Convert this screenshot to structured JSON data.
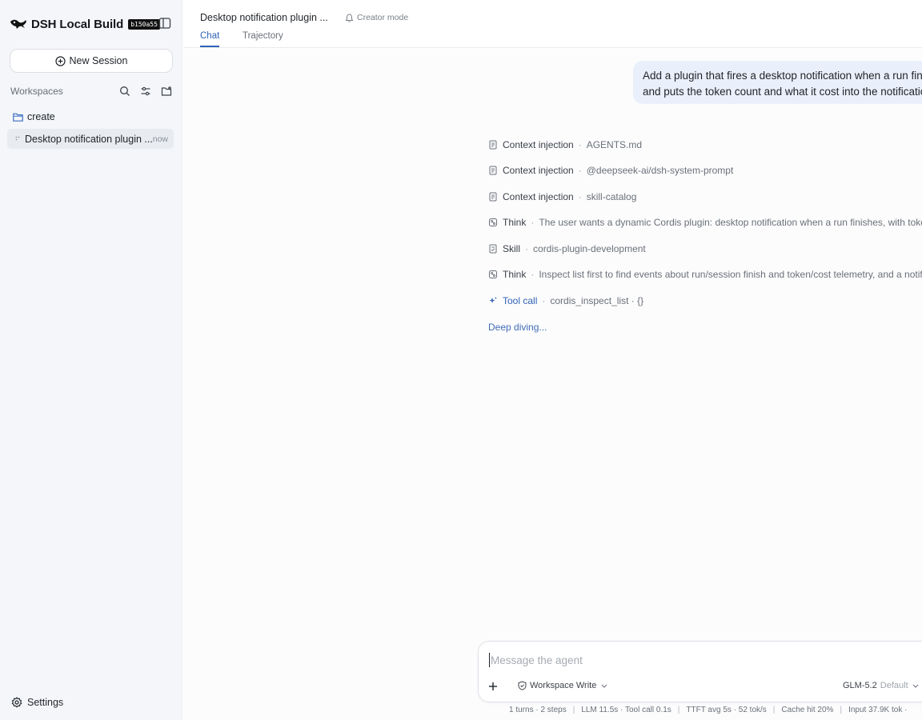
{
  "sidebar": {
    "brand_title": "DSH Local Build",
    "build_badge": "b150a55",
    "new_session_label": "New Session",
    "workspaces_label": "Workspaces",
    "folder_name": "create",
    "session": {
      "title": "Desktop notification plugin ...",
      "time": "now"
    },
    "settings_label": "Settings"
  },
  "header": {
    "title": "Desktop notification plugin ...",
    "creator_mode": "Creator mode",
    "tabs": [
      {
        "label": "Chat",
        "active": true
      },
      {
        "label": "Trajectory",
        "active": false
      }
    ]
  },
  "chat": {
    "user_message": {
      "line1": "Add a plugin that fires a desktop notification when a run fini",
      "line2": "and puts the token count and what it cost into the notificatio"
    },
    "steps": [
      {
        "icon": "document-icon",
        "kind": "Context injection",
        "detail": "AGENTS.md"
      },
      {
        "icon": "document-icon",
        "kind": "Context injection",
        "detail": "@deepseek-ai/dsh-system-prompt"
      },
      {
        "icon": "document-icon",
        "kind": "Context injection",
        "detail": "skill-catalog"
      },
      {
        "icon": "brain-icon",
        "kind": "Think",
        "detail": "The user wants a dynamic Cordis plugin: desktop notification when a run finishes, with token"
      },
      {
        "icon": "skill-icon",
        "kind": "Skill",
        "detail": "cordis-plugin-development"
      },
      {
        "icon": "brain-icon",
        "kind": "Think",
        "detail": "Inspect list first to find events about run/session finish and token/cost telemetry, and a notifi"
      },
      {
        "icon": "sparkle-icon",
        "kind": "Tool call",
        "detail": "cordis_inspect_list · {}"
      }
    ],
    "status": "Deep diving..."
  },
  "composer": {
    "placeholder": "Message the agent",
    "mode": "Workspace Write",
    "model": "GLM-5.2",
    "model_sub": "Default"
  },
  "stats": {
    "turns": "1 turns · 2 steps",
    "llm": "LLM 11.5s · Tool call 0.1s",
    "ttft": "TTFT avg 5s · 52 tok/s",
    "cache": "Cache hit 20%",
    "input": "Input 37.9K tok ·"
  },
  "colors": {
    "accent": "#2f62b5",
    "sidebar_bg": "#f4f6f9",
    "bubble_bg": "#eaf0fb"
  }
}
